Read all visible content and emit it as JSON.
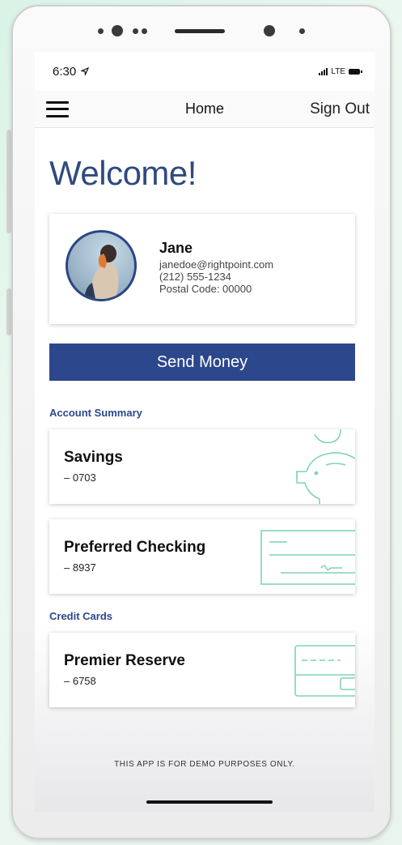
{
  "status_bar": {
    "time": "6:30",
    "network": "LTE"
  },
  "nav": {
    "title": "Home",
    "sign_out": "Sign Out"
  },
  "welcome": "Welcome!",
  "profile": {
    "name": "Jane",
    "email": "janedoe@rightpoint.com",
    "phone": "(212) 555-1234",
    "postal": "Postal Code: 00000"
  },
  "send_money": "Send Money",
  "account_summary": {
    "label": "Account Summary",
    "accounts": [
      {
        "name": "Savings",
        "number": "– 0703",
        "icon": "piggy-bank-icon"
      },
      {
        "name": "Preferred Checking",
        "number": "– 8937",
        "icon": "check-icon"
      }
    ]
  },
  "credit_cards": {
    "label": "Credit Cards",
    "cards": [
      {
        "name": "Premier Reserve",
        "number": "– 6758",
        "icon": "credit-card-icon"
      }
    ]
  },
  "footer": "THIS APP IS FOR DEMO PURPOSES ONLY.",
  "colors": {
    "primary": "#2c478c",
    "accent_icon": "#7fd4b4"
  }
}
